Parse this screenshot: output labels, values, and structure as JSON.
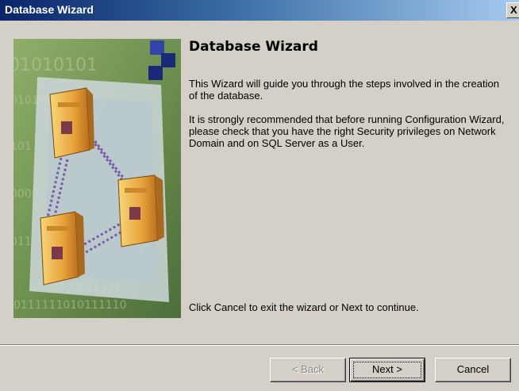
{
  "window": {
    "title": "Database Wizard",
    "close_glyph": "X"
  },
  "content": {
    "heading": "Database Wizard",
    "intro": "This Wizard will guide you through the steps involved in the creation of the database.",
    "recommendation": "It is strongly recommended that before running Configuration Wizard, please check that you have the right Security privileges on Network Domain and on SQL Server as a User.",
    "footer_hint": "Click Cancel to exit the wizard or Next to continue."
  },
  "buttons": {
    "back": {
      "label": "< Back",
      "mnemonic": "k",
      "enabled": false
    },
    "next": {
      "label": "Next >",
      "mnemonic": "N",
      "enabled": true
    },
    "cancel": {
      "label": "Cancel",
      "mnemonic": "C",
      "enabled": true
    }
  },
  "colors": {
    "titlebar_start": "#0a246a",
    "titlebar_end": "#a6caf0",
    "dialog_face": "#d4d0c8"
  },
  "icons": {
    "art": "network-servers-illustration",
    "close": "close-icon"
  }
}
